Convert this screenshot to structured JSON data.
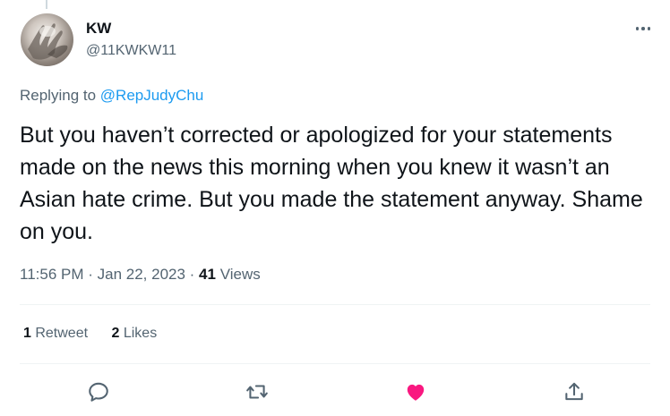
{
  "author": {
    "name": "KW",
    "handle": "@11KWKW11"
  },
  "reply": {
    "prefix": "Replying to ",
    "target": "@RepJudyChu"
  },
  "tweet": {
    "text": "But you haven’t corrected or apologized for your statements made on the news this morning when you knew it wasn’t an Asian hate crime. But you made the statement anyway. Shame on you."
  },
  "meta": {
    "time": "11:56 PM",
    "separator": " · ",
    "date": "Jan 22, 2023",
    "views_count": "41",
    "views_label": " Views"
  },
  "stats": {
    "retweets_count": "1",
    "retweets_label": " Retweet",
    "likes_count": "2",
    "likes_label": " Likes"
  },
  "actions": {
    "reply_icon": "reply-icon",
    "retweet_icon": "retweet-icon",
    "like_icon": "heart-icon",
    "like_color": "#f91880",
    "share_icon": "share-icon",
    "icon_color": "#536471"
  }
}
